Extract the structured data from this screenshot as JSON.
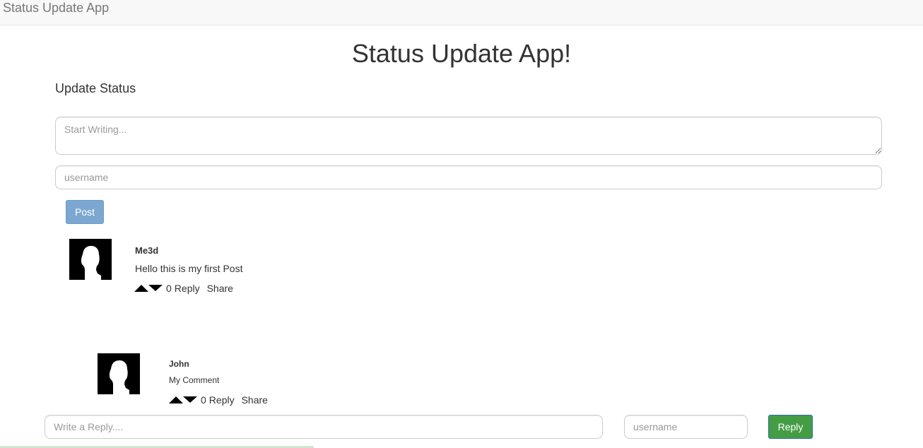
{
  "navbar": {
    "brand": "Status Update App"
  },
  "page": {
    "title": "Status Update App!",
    "section_heading": "Update Status"
  },
  "form": {
    "status_placeholder": "Start Writing...",
    "username_placeholder": "username",
    "post_label": "Post"
  },
  "posts": [
    {
      "author": "Me3d",
      "text": "Hello this is my first Post",
      "votes": "0",
      "reply_label": "Reply",
      "share_label": "Share"
    }
  ],
  "comments": [
    {
      "author": "John",
      "text": "My Comment",
      "votes": "0",
      "reply_label": "Reply",
      "share_label": "Share"
    }
  ],
  "reply_form": {
    "reply_placeholder": "Write a Reply....",
    "username_placeholder": "username",
    "reply_label": "Reply"
  },
  "icons": {
    "avatar": "user-silhouette-icon",
    "upvote": "triangle-up-icon",
    "downvote": "triangle-down-icon"
  },
  "colors": {
    "post_button": "#7ca7d1",
    "reply_button": "#449d44",
    "navbar_bg": "#f8f8f8"
  },
  "page_load_progress": 0.34
}
